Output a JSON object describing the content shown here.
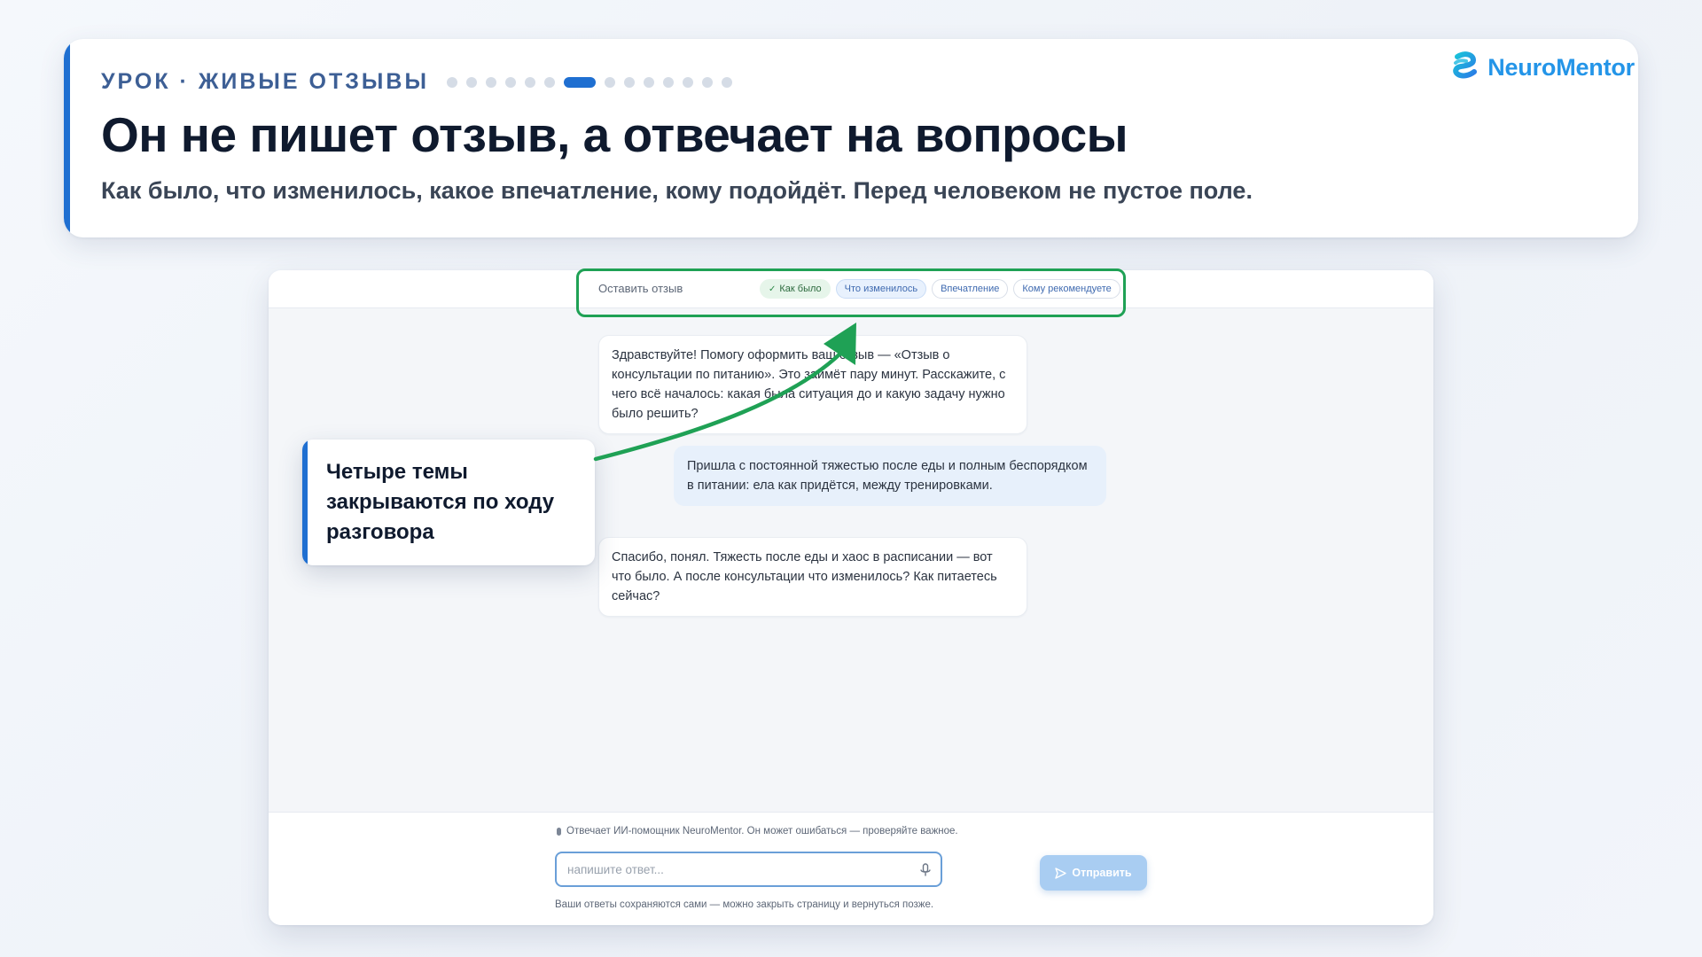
{
  "header": {
    "lesson_label": "УРОК · ЖИВЫЕ ОТЗЫВЫ",
    "progress": {
      "total_steps": 14,
      "current_step": 7
    },
    "title": "Он не пишет отзыв, а отвечает на вопросы",
    "subtitle": "Как было, что изменилось, какое впечатление, кому подойдёт. Перед человеком не пустое поле."
  },
  "brand": {
    "name": "NeuroMentor",
    "icon": "neuromentor-logo-icon",
    "color": "#2495e8"
  },
  "app": {
    "topbar_title": "Оставить отзыв",
    "chips": [
      {
        "label": "Как было",
        "state": "done",
        "icon": "check-icon"
      },
      {
        "label": "Что изменилось",
        "state": "current"
      },
      {
        "label": "Впечатление",
        "state": "pending"
      },
      {
        "label": "Кому рекомендуете",
        "state": "pending"
      }
    ],
    "messages": [
      {
        "role": "bot",
        "text": "Здравствуйте! Помогу оформить ваш отзыв — «Отзыв о консультации по питанию». Это займёт пару минут. Расскажите, с чего всё началось: какая была ситуация до и какую задачу нужно было решить?"
      },
      {
        "role": "user",
        "text": "Пришла с постоянной тяжестью после еды и полным беспорядком в питании: ела как придётся, между тренировками."
      },
      {
        "role": "bot",
        "text": "Спасибо, понял. Тяжесть после еды и хаос в расписании — вот что было. А после консультации что изменилось? Как питаетесь сейчас?"
      }
    ],
    "disclaimer": "Отвечает ИИ-помощник NeuroMentor. Он может ошибаться — проверяйте важное.",
    "input": {
      "placeholder": "напишите ответ...",
      "value": ""
    },
    "send_label": "Отправить",
    "save_note": "Ваши ответы сохраняются сами — можно закрыть страницу и вернуться позже."
  },
  "callout": {
    "text": "Четыре темы закрываются по ходу разговора"
  },
  "colors": {
    "accent_blue": "#1f6fd1",
    "highlight_green": "#1fa155"
  }
}
